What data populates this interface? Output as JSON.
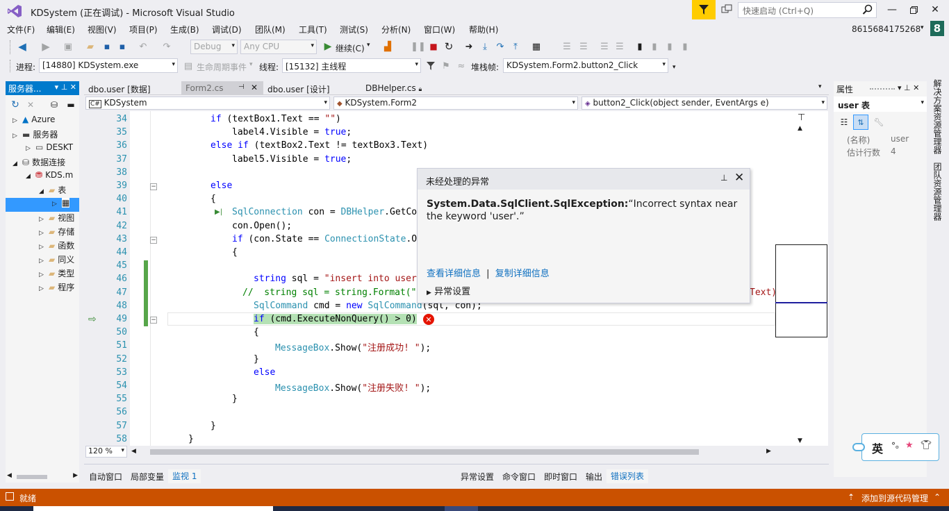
{
  "window": {
    "title": "KDSystem (正在调试) - Microsoft Visual Studio",
    "quick_launch_placeholder": "快速启动 (Ctrl+Q)",
    "account": "8615684175268",
    "avatar_letter": "8"
  },
  "menu": [
    "文件(F)",
    "编辑(E)",
    "视图(V)",
    "项目(P)",
    "生成(B)",
    "调试(D)",
    "团队(M)",
    "工具(T)",
    "测试(S)",
    "分析(N)",
    "窗口(W)",
    "帮助(H)"
  ],
  "toolbar": {
    "config": "Debug",
    "platform": "Any CPU",
    "continue_label": "继续(C)"
  },
  "debugbar": {
    "process_label": "进程:",
    "process_value": "[14880] KDSystem.exe",
    "lifecycle_label": "生命周期事件",
    "thread_label": "线程:",
    "thread_value": "[15132] 主线程",
    "stackframe_label": "堆栈帧:",
    "stackframe_value": "KDSystem.Form2.button2_Click"
  },
  "server_explorer": {
    "title": "服务器...",
    "items": [
      {
        "label": "Azure",
        "level": 0,
        "expander": "▷",
        "icon": "azure-icon"
      },
      {
        "label": "服务器",
        "level": 0,
        "expander": "▷",
        "icon": "server-icon"
      },
      {
        "label": "DESKT",
        "level": 1,
        "expander": "▷",
        "icon": "computer-icon"
      },
      {
        "label": "数据连接",
        "level": 0,
        "expander": "◢",
        "icon": "data-connection-icon"
      },
      {
        "label": "KDS.m",
        "level": 1,
        "expander": "◢",
        "icon": "database-error-icon"
      },
      {
        "label": "表",
        "level": 2,
        "expander": "◢",
        "icon": "folder-icon"
      },
      {
        "label": "",
        "level": 3,
        "expander": "▷",
        "icon": "table-icon",
        "selected": true
      },
      {
        "label": "视图",
        "level": 2,
        "expander": "▷",
        "icon": "folder-icon"
      },
      {
        "label": "存储",
        "level": 2,
        "expander": "▷",
        "icon": "folder-icon"
      },
      {
        "label": "函数",
        "level": 2,
        "expander": "▷",
        "icon": "folder-icon"
      },
      {
        "label": "同义",
        "level": 2,
        "expander": "▷",
        "icon": "folder-icon"
      },
      {
        "label": "类型",
        "level": 2,
        "expander": "▷",
        "icon": "folder-icon"
      },
      {
        "label": "程序",
        "level": 2,
        "expander": "▷",
        "icon": "folder-icon"
      }
    ]
  },
  "doc_tabs": [
    {
      "label": "dbo.user [数据]",
      "active": false
    },
    {
      "label": "Form2.cs",
      "active": true
    },
    {
      "label": "dbo.user [设计]",
      "active": false
    },
    {
      "label": "DBHelper.cs",
      "active": false
    }
  ],
  "navbar": {
    "project": "KDSystem",
    "class": "KDSystem.Form2",
    "member": "button2_Click(object sender, EventArgs e)"
  },
  "code_lines": [
    {
      "n": "34",
      "html": "<span class='kw'>if</span> (textBox1.Text == <span class='st'>\"\"</span>)",
      "indent": 182
    },
    {
      "n": "35",
      "html": "label4.Visible = <span class='kw'>true</span>;",
      "indent": 213
    },
    {
      "n": "36",
      "html": "<span class='kw'>else if</span> (textBox2.Text != textBox3.Text)",
      "indent": 182
    },
    {
      "n": "37",
      "html": "label5.Visible = <span class='kw'>true</span>;",
      "indent": 213
    },
    {
      "n": "38",
      "html": "",
      "indent": 182
    },
    {
      "n": "39",
      "html": "<span class='kw'>else</span>",
      "indent": 182
    },
    {
      "n": "40",
      "html": "{",
      "indent": 182
    },
    {
      "n": "41",
      "html": "<span class='ty'>SqlConnection</span> con = <span class='ty'>DBHelper</span>.GetCo",
      "indent": 213
    },
    {
      "n": "42",
      "html": "con.Open();",
      "indent": 213
    },
    {
      "n": "43",
      "html": "<span class='kw'>if</span> (con.State == <span class='ty'>ConnectionState</span>.O",
      "indent": 213
    },
    {
      "n": "44",
      "html": "{",
      "indent": 213
    },
    {
      "n": "45",
      "html": "",
      "indent": 213
    },
    {
      "n": "46",
      "html": "<span class='kw'>string</span> sql = <span class='st'>\"insert into user</span>",
      "indent": 244
    },
    {
      "n": "47",
      "html": "<span class='cm'>//  string sql = string.Format(\"</span>",
      "indent": 228
    },
    {
      "n": "48",
      "html": "<span class='ty'>SqlCommand</span> cmd = <span class='kw'>new</span> <span class='ty'>SqlCommand</span>(sql, con);",
      "indent": 244
    },
    {
      "n": "49",
      "html": "<span style='background:#b4e1b4'><span class='kw'>if</span> (cmd.ExecuteNonQuery() > 0)</span>",
      "indent": 244
    },
    {
      "n": "50",
      "html": "{",
      "indent": 244
    },
    {
      "n": "51",
      "html": "<span class='ty'>MessageBox</span>.Show(<span class='st'>\"注册成功! \"</span>);",
      "indent": 275
    },
    {
      "n": "52",
      "html": "}",
      "indent": 244
    },
    {
      "n": "53",
      "html": "<span class='kw'>else</span>",
      "indent": 244
    },
    {
      "n": "54",
      "html": "<span class='ty'>MessageBox</span>.Show(<span class='st'>\"注册失败! \"</span>);",
      "indent": 275
    },
    {
      "n": "55",
      "html": "}",
      "indent": 213
    },
    {
      "n": "56",
      "html": "",
      "indent": 182
    },
    {
      "n": "57",
      "html": "}",
      "indent": 182
    },
    {
      "n": "58",
      "html": "}",
      "indent": 150
    }
  ],
  "code_tail_47": "Text)",
  "exception": {
    "title": "未经处理的异常",
    "type": "System.Data.SqlClient.SqlException:",
    "message": "“Incorrect syntax near the keyword 'user'.”",
    "link_details": "查看详细信息",
    "link_copy": "复制详细信息",
    "settings": "异常设置"
  },
  "zoom": "120 %",
  "bottom_tabs_left": [
    "自动窗口",
    "局部变量",
    "监视 1"
  ],
  "bottom_tabs_right": [
    "异常设置",
    "命令窗口",
    "即时窗口",
    "输出",
    "错误列表"
  ],
  "properties": {
    "title": "属性",
    "object": "user 表",
    "rows": [
      {
        "name": "(名称)",
        "value": "user"
      },
      {
        "name": "估计行数",
        "value": "4"
      }
    ]
  },
  "side_tabs": [
    "解决方案资源管理器",
    "团队资源管理器"
  ],
  "status": {
    "left": "就绪",
    "right": "添加到源代码管理"
  },
  "ime": {
    "label": "英"
  }
}
